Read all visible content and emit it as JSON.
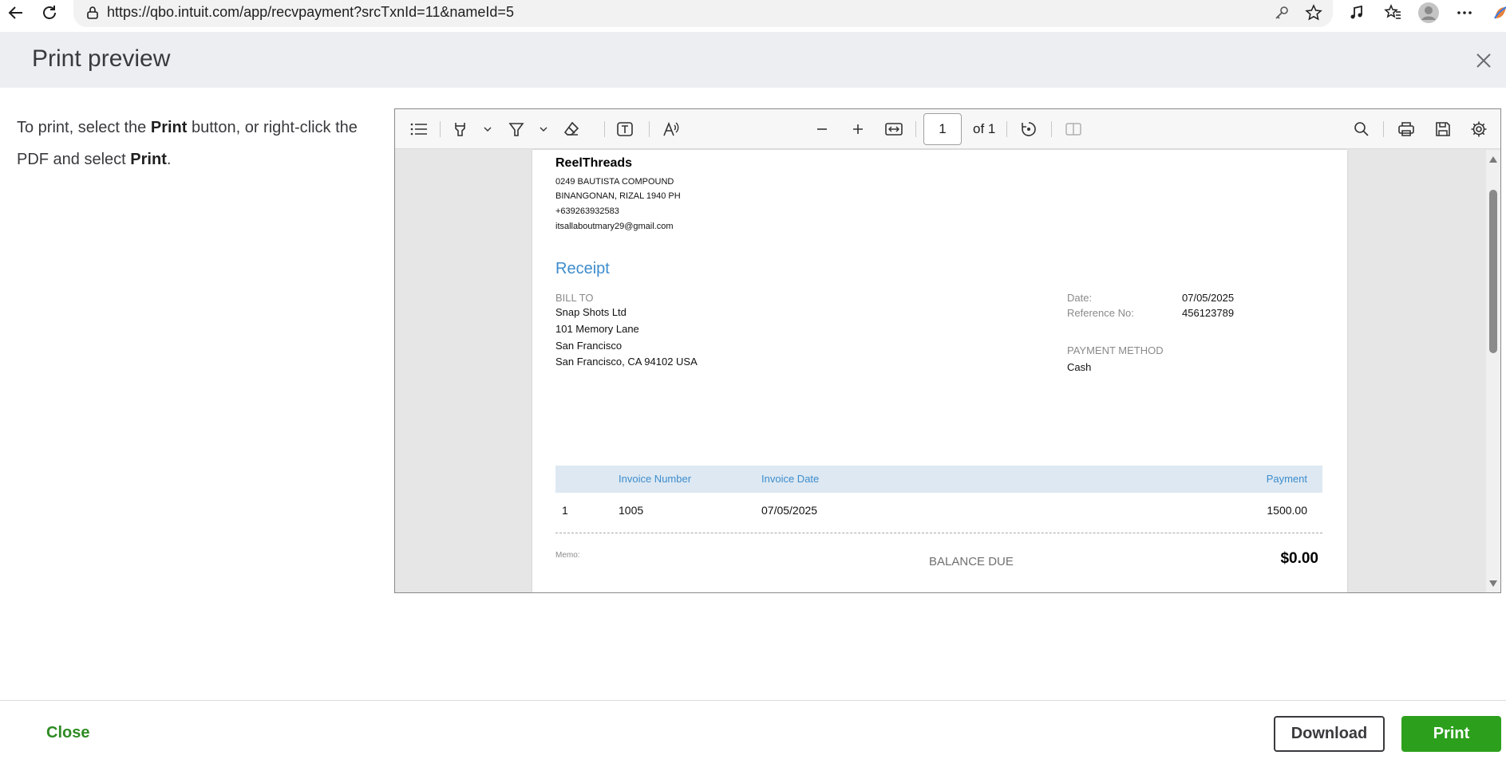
{
  "browser": {
    "url": "https://qbo.intuit.com/app/recvpayment?srcTxnId=11&nameId=5",
    "icons": [
      "back-arrow-icon",
      "refresh-icon",
      "site-info-icon",
      "key-icon",
      "star-icon",
      "music-icon",
      "favorites-icon",
      "profile-icon",
      "more-icon"
    ]
  },
  "modal": {
    "title": "Print preview",
    "instructions": {
      "part1": "To print, select the ",
      "print_word_1": "Print",
      "part2": " button, or right-click the PDF and select ",
      "print_word_2": "Print",
      "part3": "."
    }
  },
  "pdf_toolbar": {
    "page_current": "1",
    "page_total": "of 1"
  },
  "receipt": {
    "company_name": "ReelThreads",
    "address_line1": "0249 BAUTISTA COMPOUND",
    "address_line2": "BINANGONAN, RIZAL  1940 PH",
    "phone": "+639263932583",
    "email": "itsallaboutmary29@gmail.com",
    "title": "Receipt",
    "bill_to_label": "BILL TO",
    "bill_to": [
      "Snap Shots Ltd",
      "101 Memory Lane",
      "San Francisco",
      "San Francisco, CA  94102 USA"
    ],
    "date_label": "Date:",
    "date_value": "07/05/2025",
    "ref_label": "Reference No:",
    "ref_value": "456123789",
    "payment_method_label": "PAYMENT METHOD",
    "payment_method_value": "Cash",
    "table": {
      "headers": {
        "invoice_number": "Invoice Number",
        "invoice_date": "Invoice Date",
        "payment": "Payment"
      },
      "rows": [
        {
          "index": "1",
          "invoice_number": "1005",
          "invoice_date": "07/05/2025",
          "payment": "1500.00"
        }
      ]
    },
    "memo_label": "Memo:",
    "balance_due_label": "BALANCE DUE",
    "balance_due_value": "$0.00"
  },
  "footer": {
    "close_label": "Close",
    "download_label": "Download",
    "print_label": "Print"
  },
  "colors": {
    "accent_green": "#2ca01c",
    "link_green": "#2e8b23",
    "receipt_blue": "#3d8ccc",
    "header_bg": "#eceef1"
  }
}
